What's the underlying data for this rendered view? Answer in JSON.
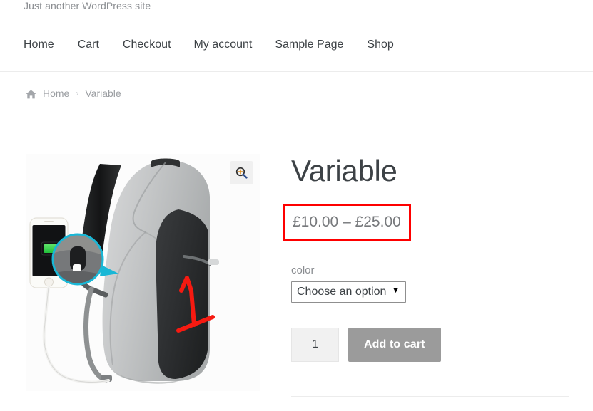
{
  "site": {
    "tagline": "Just another WordPress site"
  },
  "nav": {
    "items": [
      {
        "label": "Home"
      },
      {
        "label": "Cart"
      },
      {
        "label": "Checkout"
      },
      {
        "label": "My account"
      },
      {
        "label": "Sample Page"
      },
      {
        "label": "Shop"
      }
    ]
  },
  "breadcrumb": {
    "home_icon": "home-icon",
    "home_label": "Home",
    "separator": "›",
    "current": "Variable"
  },
  "gallery": {
    "zoom_icon": "magnifier-plus-icon",
    "alt": "Grey and black anti-theft backpack with USB charging port, shown with a white smartphone charging and a red handwritten 1 marked on the front pocket"
  },
  "product": {
    "title": "Variable",
    "price": "£10.00 – £25.00",
    "price_min": "£10.00",
    "price_max": "£25.00",
    "attribute": {
      "label": "color",
      "selected": "Choose an option",
      "options": [
        "Choose an option"
      ],
      "arrow": "▼"
    },
    "quantity": "1",
    "add_to_cart_label": "Add to cart"
  },
  "annotation": {
    "type": "rectangle-highlight",
    "target": "price",
    "color": "#fe0000"
  },
  "colors": {
    "text": "#3d4246",
    "muted": "#8a8d91",
    "button": "#9b9b9b",
    "annotation": "#fe0000",
    "divider": "#ececec"
  }
}
